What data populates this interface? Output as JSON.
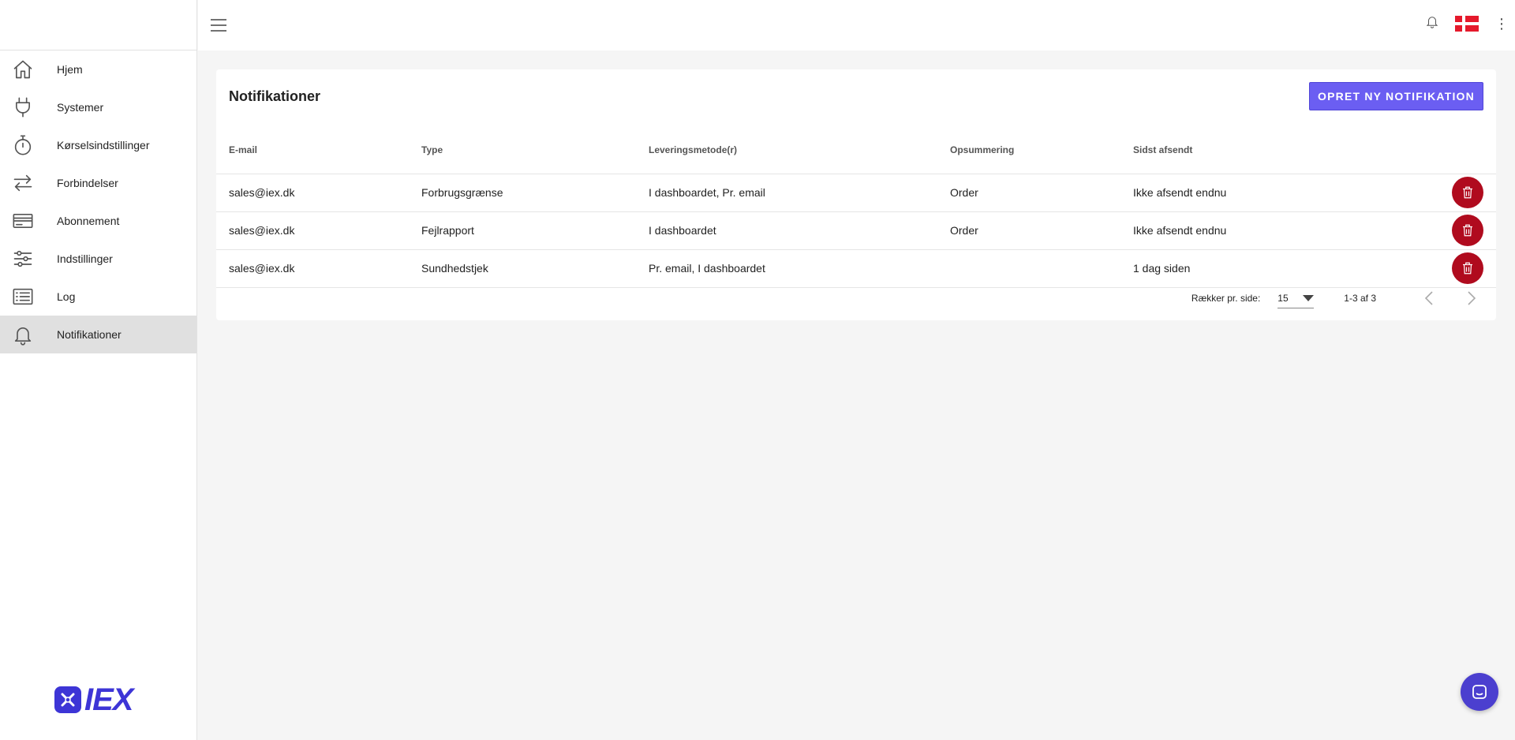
{
  "sidebar": {
    "items": [
      {
        "label": "Hjem",
        "icon": "home-icon"
      },
      {
        "label": "Systemer",
        "icon": "plug-icon"
      },
      {
        "label": "Kørselsindstillinger",
        "icon": "stopwatch-icon"
      },
      {
        "label": "Forbindelser",
        "icon": "arrows-icon"
      },
      {
        "label": "Abonnement",
        "icon": "credit-card-icon"
      },
      {
        "label": "Indstillinger",
        "icon": "sliders-icon"
      },
      {
        "label": "Log",
        "icon": "list-icon"
      },
      {
        "label": "Notifikationer",
        "icon": "bell-icon",
        "active": true
      }
    ],
    "brand": "IEX"
  },
  "page": {
    "title": "Notifikationer",
    "create_label": "OPRET NY NOTIFIKATION"
  },
  "table": {
    "columns": [
      "E-mail",
      "Type",
      "Leveringsmetode(r)",
      "Opsummering",
      "Sidst afsendt"
    ],
    "rows": [
      [
        "sales@iex.dk",
        "Forbrugsgrænse",
        "I dashboardet, Pr. email",
        "Order",
        "Ikke afsendt endnu"
      ],
      [
        "sales@iex.dk",
        "Fejlrapport",
        "I dashboardet",
        "Order",
        "Ikke afsendt endnu"
      ],
      [
        "sales@iex.dk",
        "Sundhedstjek",
        "Pr. email, I dashboardet",
        "",
        "1 dag siden"
      ]
    ]
  },
  "pagination": {
    "rows_label": "Rækker pr. side:",
    "rows_value": "15",
    "range": "1-3 af 3"
  },
  "colors": {
    "accent": "#6b5ef2",
    "delete": "#b00b1e",
    "brand": "#3d35d6"
  }
}
